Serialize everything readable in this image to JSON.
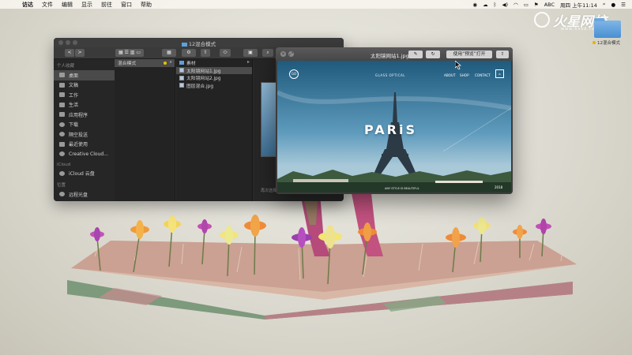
{
  "menubar": {
    "apple": "",
    "items": [
      "访达",
      "文件",
      "编辑",
      "显示",
      "前往",
      "窗口",
      "帮助"
    ],
    "status_text": "ABC",
    "clock": "周四 上午11:14"
  },
  "watermark": {
    "main": "火星网校",
    "sub": "www.hxsd.tv"
  },
  "desktop_folder": {
    "label": "12混合模式"
  },
  "finder": {
    "title": "12混合模式",
    "toolbar": {
      "back": "<",
      "forward": ">"
    },
    "sidebar": {
      "favorites_header": "个人收藏",
      "favorites": [
        {
          "label": "桌面",
          "icon": "desktop-icon"
        },
        {
          "label": "文稿",
          "icon": "documents-icon"
        },
        {
          "label": "工作",
          "icon": "folder-icon"
        },
        {
          "label": "生活",
          "icon": "folder-icon"
        },
        {
          "label": "应用程序",
          "icon": "applications-icon"
        },
        {
          "label": "下载",
          "icon": "downloads-icon"
        },
        {
          "label": "隔空投送",
          "icon": "airdrop-icon"
        },
        {
          "label": "最近使用",
          "icon": "recents-icon"
        },
        {
          "label": "Creative Cloud...",
          "icon": "creative-cloud-icon"
        }
      ],
      "icloud_header": "iCloud",
      "icloud": [
        {
          "label": "iCloud 云盘",
          "icon": "cloud-icon"
        }
      ],
      "locations_header": "位置",
      "locations": [
        {
          "label": "远程光盘",
          "icon": "disc-icon"
        }
      ]
    },
    "column1": [
      {
        "name": "混合模式",
        "tag": true
      }
    ],
    "column2": [
      {
        "name": "素材",
        "type": "folder"
      },
      {
        "name": "太阳镜网站1.jpg",
        "type": "image"
      },
      {
        "name": "太阳镜网站2.jpg",
        "type": "image"
      },
      {
        "name": "图层混合.jpg",
        "type": "image"
      }
    ],
    "preview_label": "再次选择"
  },
  "quicklook": {
    "title": "太阳镜网站1.jpg",
    "open_with": "使用“预览”打开",
    "website": {
      "brand": "GLASS OPTICAL",
      "nav": [
        "ABOUT",
        "SHOP",
        "CONTACT"
      ],
      "headline": "PARiS",
      "footer": "ANY STYLE IS BEAUTIFUL",
      "page": "2018"
    }
  },
  "colors": {
    "finder_bg": "#2b2b2b",
    "accent_folder": "#5ea0dc",
    "tag_yellow": "#e8c200"
  }
}
